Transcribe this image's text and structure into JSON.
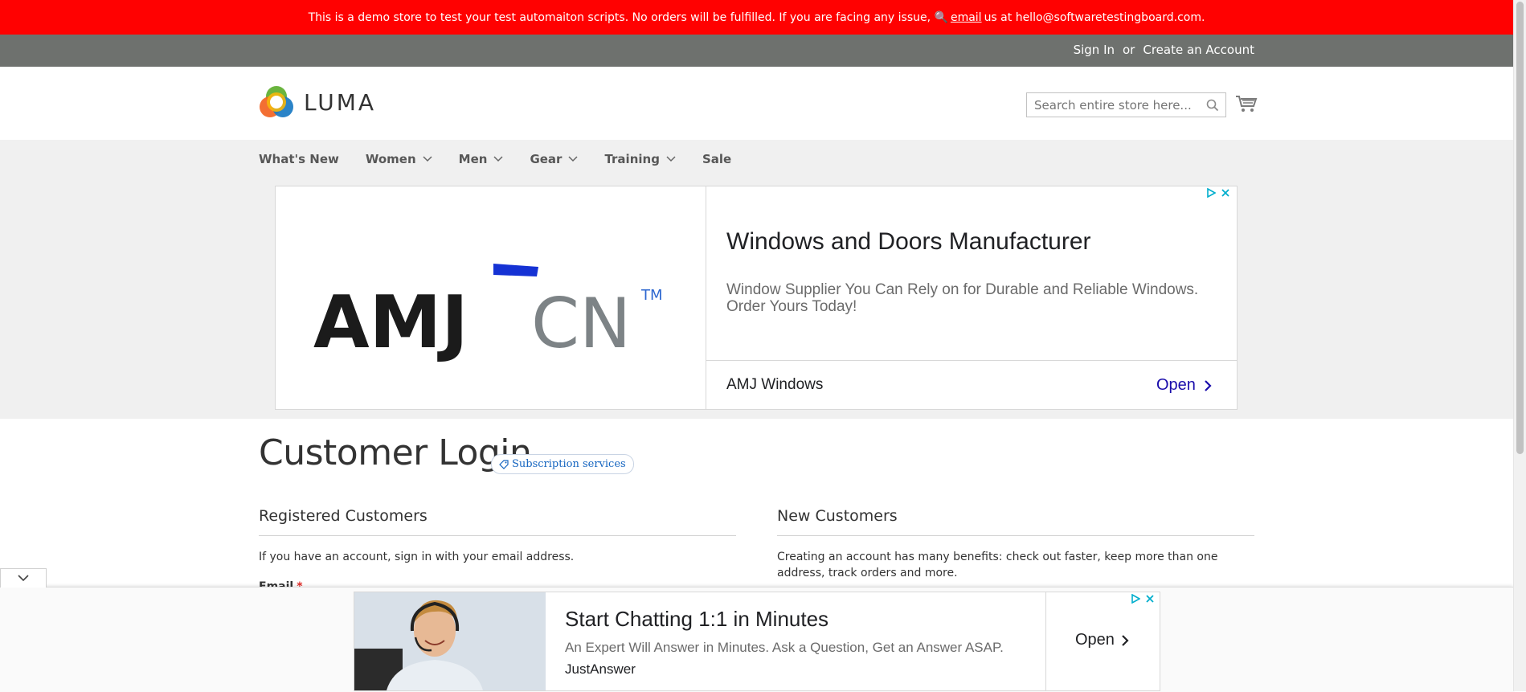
{
  "demo_banner": {
    "text_before": "This is a demo store to test your test automaiton scripts. No orders will be fulfilled. If you are facing any issue, 🔍",
    "email_link": "email",
    "text_after": "us at hello@softwaretestingboard.com."
  },
  "top_bar": {
    "sign_in": "Sign In",
    "or": "or",
    "create_account": "Create an Account"
  },
  "header": {
    "logo_text": "LUMA",
    "search": {
      "placeholder": "Search entire store here..."
    }
  },
  "nav": {
    "items": [
      {
        "label": "What's New",
        "dropdown": false
      },
      {
        "label": "Women",
        "dropdown": true
      },
      {
        "label": "Men",
        "dropdown": true
      },
      {
        "label": "Gear",
        "dropdown": true
      },
      {
        "label": "Training",
        "dropdown": true
      },
      {
        "label": "Sale",
        "dropdown": false
      }
    ]
  },
  "ad_top": {
    "logo_text_dark": "AMJ",
    "logo_text_light": "CN",
    "logo_tm": "TM",
    "headline": "Windows and Doors Manufacturer",
    "description": "Window Supplier You Can Rely on for Durable and Reliable Windows. Order Yours Today!",
    "advertiser": "AMJ Windows",
    "cta": "Open"
  },
  "page": {
    "title": "Customer Login",
    "badge": "Subscription services"
  },
  "registered": {
    "title": "Registered Customers",
    "text": "If you have an account, sign in with your email address.",
    "email_label": "Email",
    "required_mark": "*"
  },
  "new_customers": {
    "title": "New Customers",
    "text": "Creating an account has many benefits: check out faster, keep more than one address, track orders and more."
  },
  "ad_bottom": {
    "headline": "Start Chatting 1:1 in Minutes",
    "description": "An Expert Will Answer in Minutes. Ask a Question, Get an Answer ASAP.",
    "advertiser": "JustAnswer",
    "cta": "Open"
  },
  "colors": {
    "banner_red": "#ff0101",
    "top_bar_gray": "#6e716e",
    "nav_bg": "#f0f0f0",
    "link_blue": "#1a0dab",
    "required_red": "#e02b27"
  }
}
